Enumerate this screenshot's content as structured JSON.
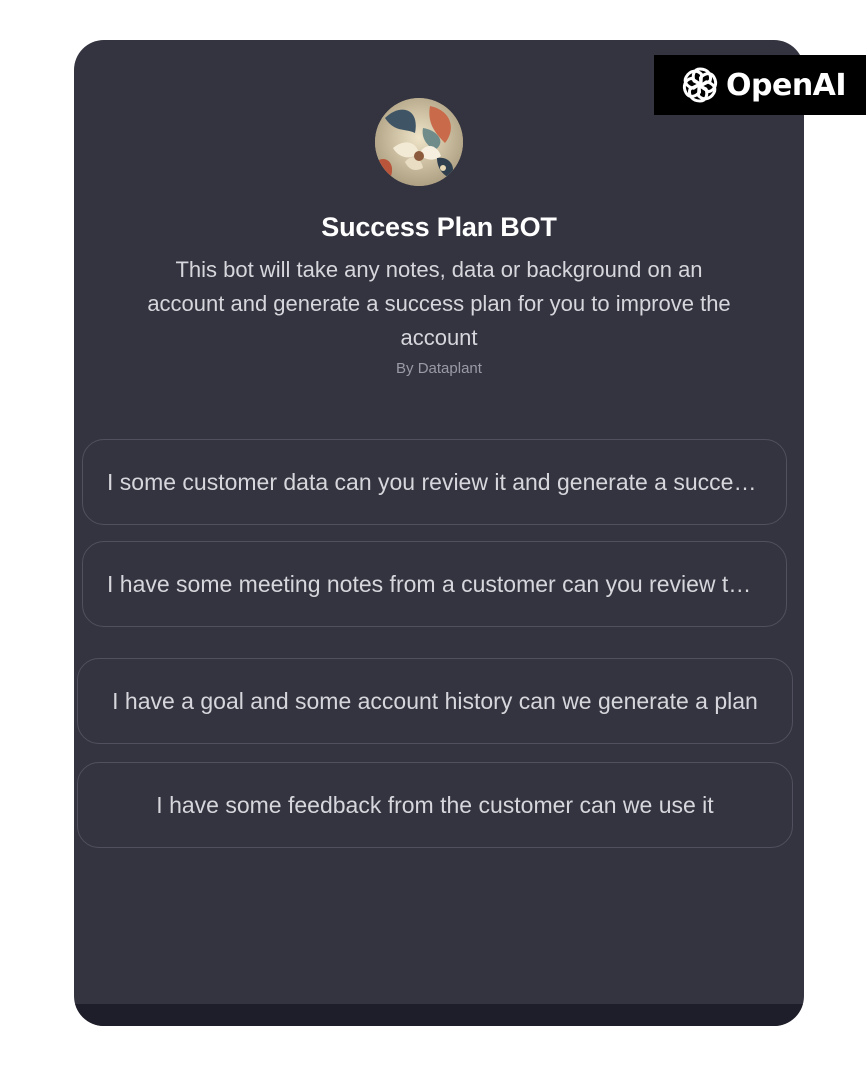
{
  "gpt": {
    "title": "Success Plan BOT",
    "description": "This bot will take any notes, data or background on an account and generate a success plan for you to improve the account",
    "author": "By Dataplant"
  },
  "conversation_starters": [
    {
      "label": "I some customer data can you review it and generate a success plan"
    },
    {
      "label": "I have some meeting notes from a customer can you review them"
    },
    {
      "label": "I have a goal and some account history can we generate a plan"
    },
    {
      "label": "I have some feedback from the customer can we use it"
    }
  ],
  "watermark": {
    "brand": "OpenAI",
    "icon": "openai-logo-icon"
  },
  "colors": {
    "card_background": "#343440",
    "starter_border": "#50505e",
    "text_primary": "#ffffff",
    "text_secondary": "#d6d6dc",
    "text_muted": "#9a9aa6",
    "badge_background": "#000000"
  }
}
